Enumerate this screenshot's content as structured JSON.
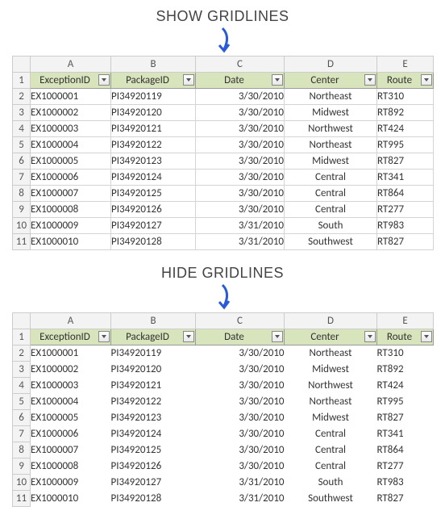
{
  "caption_show": "SHOW GRIDLINES",
  "caption_hide": "HIDE GRIDLINES",
  "columns": {
    "A": "A",
    "B": "B",
    "C": "C",
    "D": "D",
    "E": "E"
  },
  "rownums": [
    "1",
    "2",
    "3",
    "4",
    "5",
    "6",
    "7",
    "8",
    "9",
    "10",
    "11"
  ],
  "headers": {
    "exceptionId": "ExceptionID",
    "packageId": "PackageID",
    "date": "Date",
    "center": "Center",
    "route": "Route"
  },
  "rows": [
    {
      "exceptionId": "EX1000001",
      "packageId": "PI34920119",
      "date": "3/30/2010",
      "center": "Northeast",
      "route": "RT310"
    },
    {
      "exceptionId": "EX1000002",
      "packageId": "PI34920120",
      "date": "3/30/2010",
      "center": "Midwest",
      "route": "RT892"
    },
    {
      "exceptionId": "EX1000003",
      "packageId": "PI34920121",
      "date": "3/30/2010",
      "center": "Northwest",
      "route": "RT424"
    },
    {
      "exceptionId": "EX1000004",
      "packageId": "PI34920122",
      "date": "3/30/2010",
      "center": "Northeast",
      "route": "RT995"
    },
    {
      "exceptionId": "EX1000005",
      "packageId": "PI34920123",
      "date": "3/30/2010",
      "center": "Midwest",
      "route": "RT827"
    },
    {
      "exceptionId": "EX1000006",
      "packageId": "PI34920124",
      "date": "3/30/2010",
      "center": "Central",
      "route": "RT341"
    },
    {
      "exceptionId": "EX1000007",
      "packageId": "PI34920125",
      "date": "3/30/2010",
      "center": "Central",
      "route": "RT864"
    },
    {
      "exceptionId": "EX1000008",
      "packageId": "PI34920126",
      "date": "3/30/2010",
      "center": "Central",
      "route": "RT277"
    },
    {
      "exceptionId": "EX1000009",
      "packageId": "PI34920127",
      "date": "3/31/2010",
      "center": "South",
      "route": "RT983"
    },
    {
      "exceptionId": "EX1000010",
      "packageId": "PI34920128",
      "date": "3/31/2010",
      "center": "Southwest",
      "route": "RT827"
    }
  ]
}
